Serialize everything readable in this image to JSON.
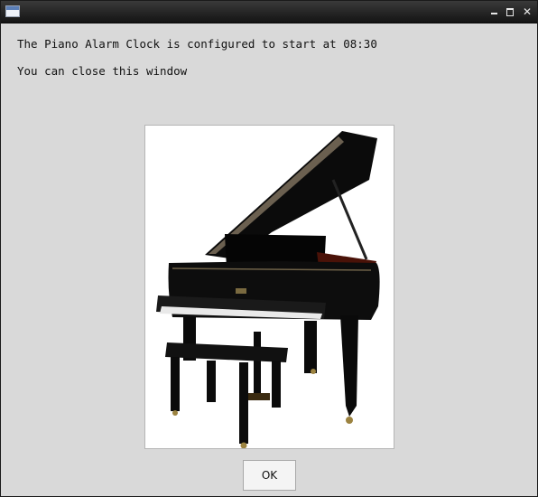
{
  "window": {
    "app_icon": "window-icon",
    "controls": {
      "minimize_icon": "minimize-icon",
      "maximize_icon": "maximize-icon",
      "close_glyph": "✕"
    }
  },
  "dialog": {
    "message_line1": "The Piano Alarm Clock is configured to start at 08:30",
    "message_line2": "You can close this window",
    "image": "grand-piano-with-bench",
    "ok_label": "OK"
  },
  "colors": {
    "background": "#d9d9d9",
    "titlebar": "#1e1e1e",
    "button": "#f4f4f4"
  }
}
